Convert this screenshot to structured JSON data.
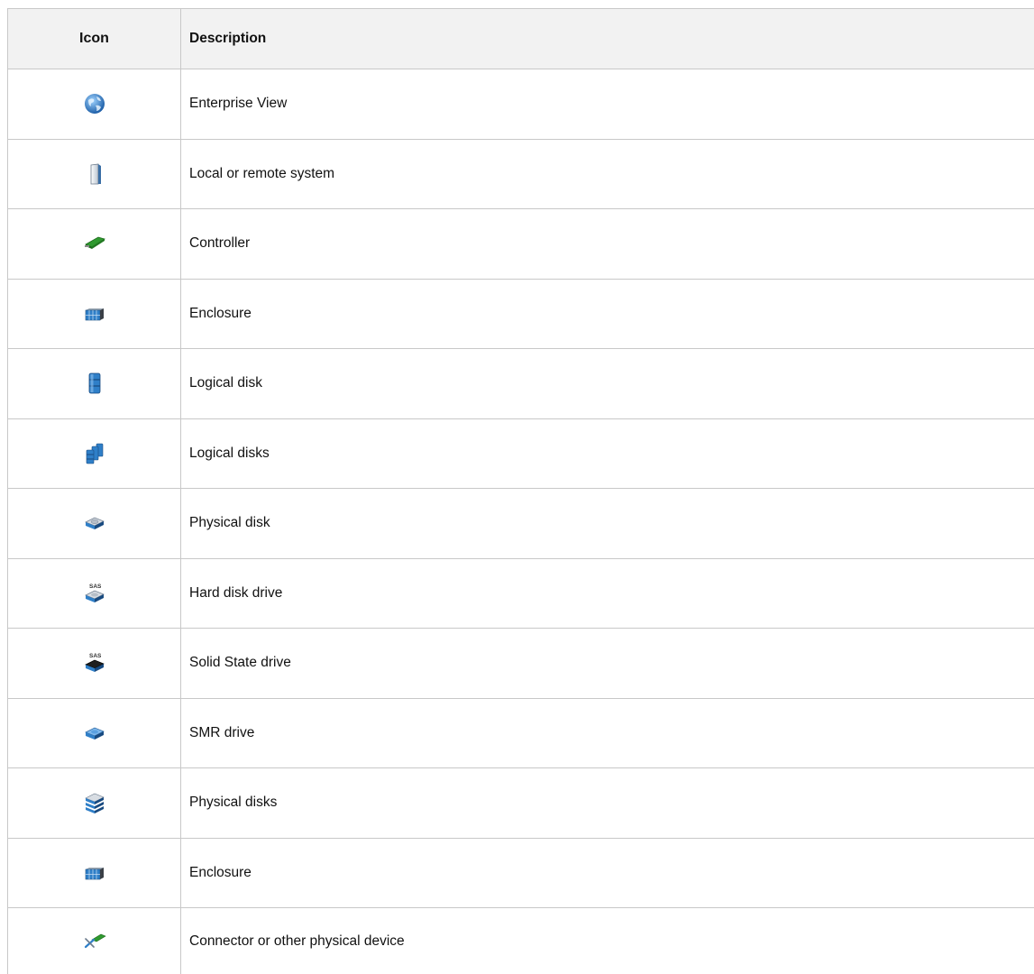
{
  "header": {
    "icon_col": "Icon",
    "desc_col": "Description"
  },
  "rows": [
    {
      "icon": "globe-icon",
      "description": "Enterprise View"
    },
    {
      "icon": "server-tower-icon",
      "description": "Local or remote system"
    },
    {
      "icon": "controller-card-icon",
      "description": "Controller"
    },
    {
      "icon": "enclosure-icon",
      "description": "Enclosure"
    },
    {
      "icon": "logical-disk-icon",
      "description": "Logical disk"
    },
    {
      "icon": "logical-disks-icon",
      "description": "Logical disks"
    },
    {
      "icon": "physical-disk-icon",
      "description": "Physical disk"
    },
    {
      "icon": "hard-disk-drive-icon",
      "description": "Hard disk drive",
      "badge": "SAS"
    },
    {
      "icon": "solid-state-drive-icon",
      "description": "Solid State drive",
      "badge": "SAS"
    },
    {
      "icon": "smr-drive-icon",
      "description": "SMR drive"
    },
    {
      "icon": "physical-disks-icon",
      "description": "Physical disks"
    },
    {
      "icon": "enclosure-icon",
      "description": "Enclosure"
    },
    {
      "icon": "connector-icon",
      "description": "Connector or other physical device"
    }
  ],
  "colors": {
    "border": "#c8c8c8",
    "header_bg": "#f2f2f2",
    "icon_blue": "#2f7fc8",
    "icon_green": "#2f9a2f"
  }
}
